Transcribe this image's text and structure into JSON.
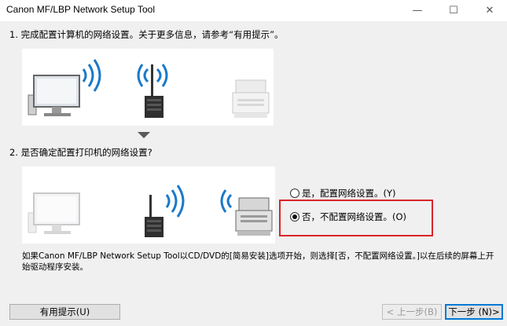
{
  "window": {
    "title": "Canon MF/LBP Network Setup Tool"
  },
  "step1": {
    "text": "1. 完成配置计算机的网络设置。关于更多信息，请参考“有用提示”。"
  },
  "step2": {
    "text": "2. 是否确定配置打印机的网络设置?"
  },
  "options": [
    {
      "label": "是，配置网络设置。(Y)",
      "selected": false
    },
    {
      "label": "否，不配置网络设置。(O)",
      "selected": true
    }
  ],
  "note": "如果Canon MF/LBP Network Setup Tool以CD/DVD的[简易安装]选项开始，则选择[否，不配置网络设置。]以在后续的屏幕上开始驱动程序安装。",
  "buttons": {
    "tips": "有用提示(U)",
    "back": "< 上一步(B)",
    "next": "下一步 (N)>"
  },
  "colors": {
    "highlight": "#d9252b",
    "wave": "#1b79c9",
    "accent": "#0078d7"
  },
  "icons": [
    "minimize-icon",
    "maximize-icon",
    "close-icon",
    "computer-icon",
    "router-icon",
    "printer-icon",
    "wifi-wave-icon",
    "arrow-down-icon"
  ]
}
